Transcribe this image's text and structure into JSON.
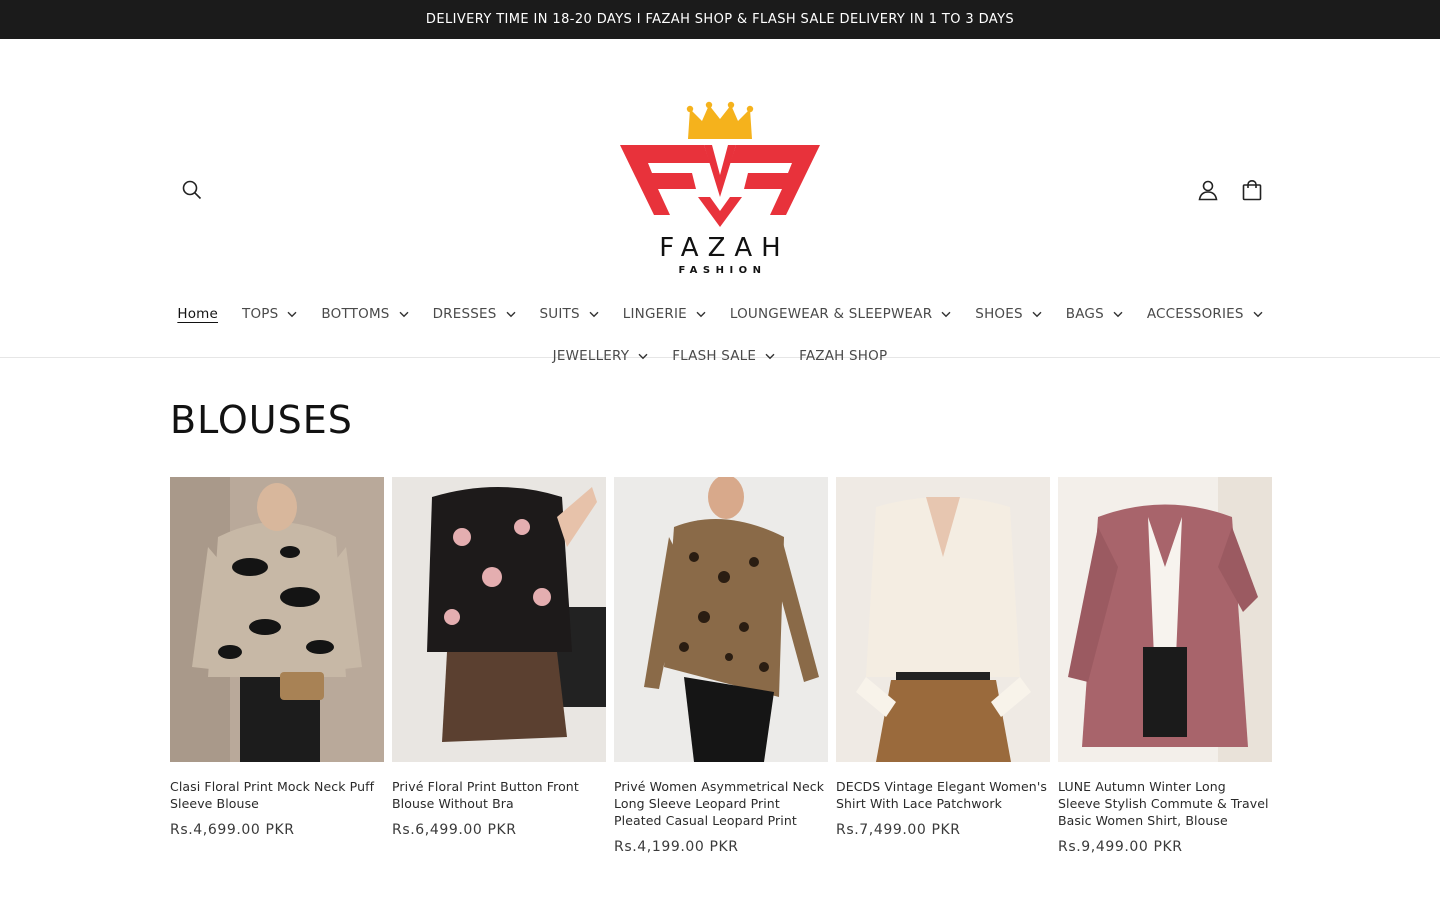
{
  "announcement": {
    "text": "DELIVERY TIME IN 18-20 DAYS I FAZAH SHOP & FLASH SALE DELIVERY IN 1 TO 3 DAYS"
  },
  "header": {
    "logo": {
      "wordmark": "FAZAH",
      "tagline": "FASHION"
    },
    "icons": {
      "search": "search-icon",
      "account": "user-icon",
      "cart": "shopping-bag-icon"
    }
  },
  "nav": {
    "row1": [
      {
        "label": "Home",
        "dropdown": false,
        "active": true
      },
      {
        "label": "TOPS",
        "dropdown": true
      },
      {
        "label": "BOTTOMS",
        "dropdown": true
      },
      {
        "label": "DRESSES",
        "dropdown": true
      },
      {
        "label": "SUITS",
        "dropdown": true
      },
      {
        "label": "LINGERIE",
        "dropdown": true
      },
      {
        "label": "LOUNGEWEAR & SLEEPWEAR",
        "dropdown": true
      },
      {
        "label": "SHOES",
        "dropdown": true
      },
      {
        "label": "BAGS",
        "dropdown": true
      },
      {
        "label": "ACCESSORIES",
        "dropdown": true
      }
    ],
    "row2": [
      {
        "label": "JEWELLERY",
        "dropdown": true
      },
      {
        "label": "FLASH SALE",
        "dropdown": true
      },
      {
        "label": "FAZAH SHOP",
        "dropdown": false
      }
    ]
  },
  "collection": {
    "title": "BLOUSES",
    "products": [
      {
        "title": "Clasi Floral Print Mock Neck Puff Sleeve Blouse",
        "price": "Rs.4,699.00 PKR"
      },
      {
        "title": "Privé Floral Print Button Front Blouse Without Bra",
        "price": "Rs.6,499.00 PKR"
      },
      {
        "title": "Privé Women Asymmetrical Neck Long Sleeve Leopard Print Pleated Casual Leopard Print",
        "price": "Rs.4,199.00 PKR"
      },
      {
        "title": "DECDS Vintage Elegant Women's Shirt With Lace Patchwork",
        "price": "Rs.7,499.00 PKR"
      },
      {
        "title": "LUNE Autumn Winter Long Sleeve Stylish Commute & Travel Basic Women Shirt, Blouse",
        "price": "Rs.9,499.00 PKR"
      }
    ]
  },
  "colors": {
    "announcement_bg": "#1b1b1b",
    "logo_red": "#e8323b",
    "logo_gold": "#f5b21c"
  }
}
